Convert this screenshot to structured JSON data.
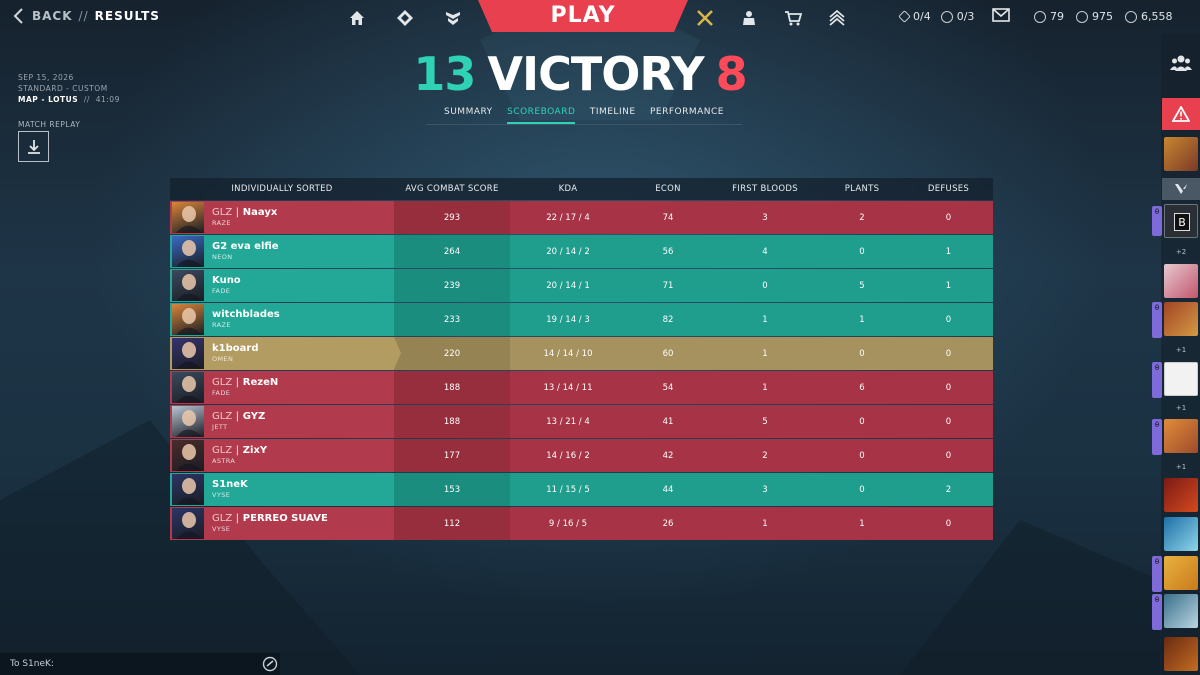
{
  "header": {
    "back_label": "BACK",
    "separator": "//",
    "page_title": "RESULTS",
    "play_label": "PLAY",
    "kingdom_credits": "0/4",
    "radianite_points": "0/3",
    "vp": "79",
    "rp": "975",
    "kc": "6,558"
  },
  "match": {
    "date": "SEP 15, 2026",
    "mode": "STANDARD - CUSTOM",
    "map": "MAP - LOTUS",
    "sep": "//",
    "duration": "41:09",
    "replay_label": "MATCH REPLAY"
  },
  "score": {
    "team_score": "13",
    "result": "VICTORY",
    "enemy_score": "8"
  },
  "tabs": [
    {
      "label": "SUMMARY"
    },
    {
      "label": "SCOREBOARD"
    },
    {
      "label": "TIMELINE"
    },
    {
      "label": "PERFORMANCE"
    }
  ],
  "table": {
    "headers": [
      "INDIVIDUALLY SORTED",
      "AVG COMBAT SCORE",
      "KDA",
      "ECON",
      "FIRST BLOODS",
      "PLANTS",
      "DEFUSES"
    ],
    "rows": [
      {
        "tag": "GLZ",
        "name": "Naayx",
        "agent": "RAZE",
        "acs": "293",
        "kda": "22 / 17 / 4",
        "econ": "74",
        "fb": "3",
        "plants": "2",
        "defuses": "0",
        "team": "red",
        "avatar": "#d9863a"
      },
      {
        "tag": "",
        "name": "G2 eva elfie",
        "agent": "NEON",
        "acs": "264",
        "kda": "20 / 14 / 2",
        "econ": "56",
        "fb": "4",
        "plants": "0",
        "defuses": "1",
        "team": "teal",
        "avatar": "#3a6bc4"
      },
      {
        "tag": "",
        "name": "Kuno",
        "agent": "FADE",
        "acs": "239",
        "kda": "20 / 14 / 1",
        "econ": "71",
        "fb": "0",
        "plants": "5",
        "defuses": "1",
        "team": "teal",
        "avatar": "#3b4a5e"
      },
      {
        "tag": "",
        "name": "witchblades",
        "agent": "RAZE",
        "acs": "233",
        "kda": "19 / 14 / 3",
        "econ": "82",
        "fb": "1",
        "plants": "1",
        "defuses": "0",
        "team": "teal",
        "avatar": "#d9863a"
      },
      {
        "tag": "",
        "name": "k1board",
        "agent": "OMEN",
        "acs": "220",
        "kda": "14 / 14 / 10",
        "econ": "60",
        "fb": "1",
        "plants": "0",
        "defuses": "0",
        "team": "gold",
        "avatar": "#37336e"
      },
      {
        "tag": "GLZ",
        "name": "RezeN",
        "agent": "FADE",
        "acs": "188",
        "kda": "13 / 14 / 11",
        "econ": "54",
        "fb": "1",
        "plants": "6",
        "defuses": "0",
        "team": "red",
        "avatar": "#3b4a5e"
      },
      {
        "tag": "GLZ",
        "name": "GYZ",
        "agent": "JETT",
        "acs": "188",
        "kda": "13 / 21 / 4",
        "econ": "41",
        "fb": "5",
        "plants": "0",
        "defuses": "0",
        "team": "red",
        "avatar": "#b9c6d4"
      },
      {
        "tag": "GLZ",
        "name": "ZixY",
        "agent": "ASTRA",
        "acs": "177",
        "kda": "14 / 16 / 2",
        "econ": "42",
        "fb": "2",
        "plants": "0",
        "defuses": "0",
        "team": "red",
        "avatar": "#4a2c2a"
      },
      {
        "tag": "",
        "name": "S1neK",
        "agent": "VYSE",
        "acs": "153",
        "kda": "11 / 15 / 5",
        "econ": "44",
        "fb": "3",
        "plants": "0",
        "defuses": "2",
        "team": "teal",
        "avatar": "#2c3566"
      },
      {
        "tag": "GLZ",
        "name": "PERREO SUAVE",
        "agent": "VYSE",
        "acs": "112",
        "kda": "9 / 16 / 5",
        "econ": "26",
        "fb": "1",
        "plants": "1",
        "defuses": "0",
        "team": "red",
        "avatar": "#2c3566"
      }
    ]
  },
  "chat": {
    "placeholder": "To S1neK:"
  },
  "social": {
    "party_more_1": "+2",
    "party_more_2": "+1",
    "party_more_3": "+1",
    "party_more_4": "+1"
  },
  "colors": {
    "win": "#2fd2b4",
    "lose": "#ff4a5a",
    "play_bg": "#e8404f",
    "red_row": "#a73446",
    "teal_row": "#1f9d8d",
    "gold_row": "#a6925e"
  }
}
